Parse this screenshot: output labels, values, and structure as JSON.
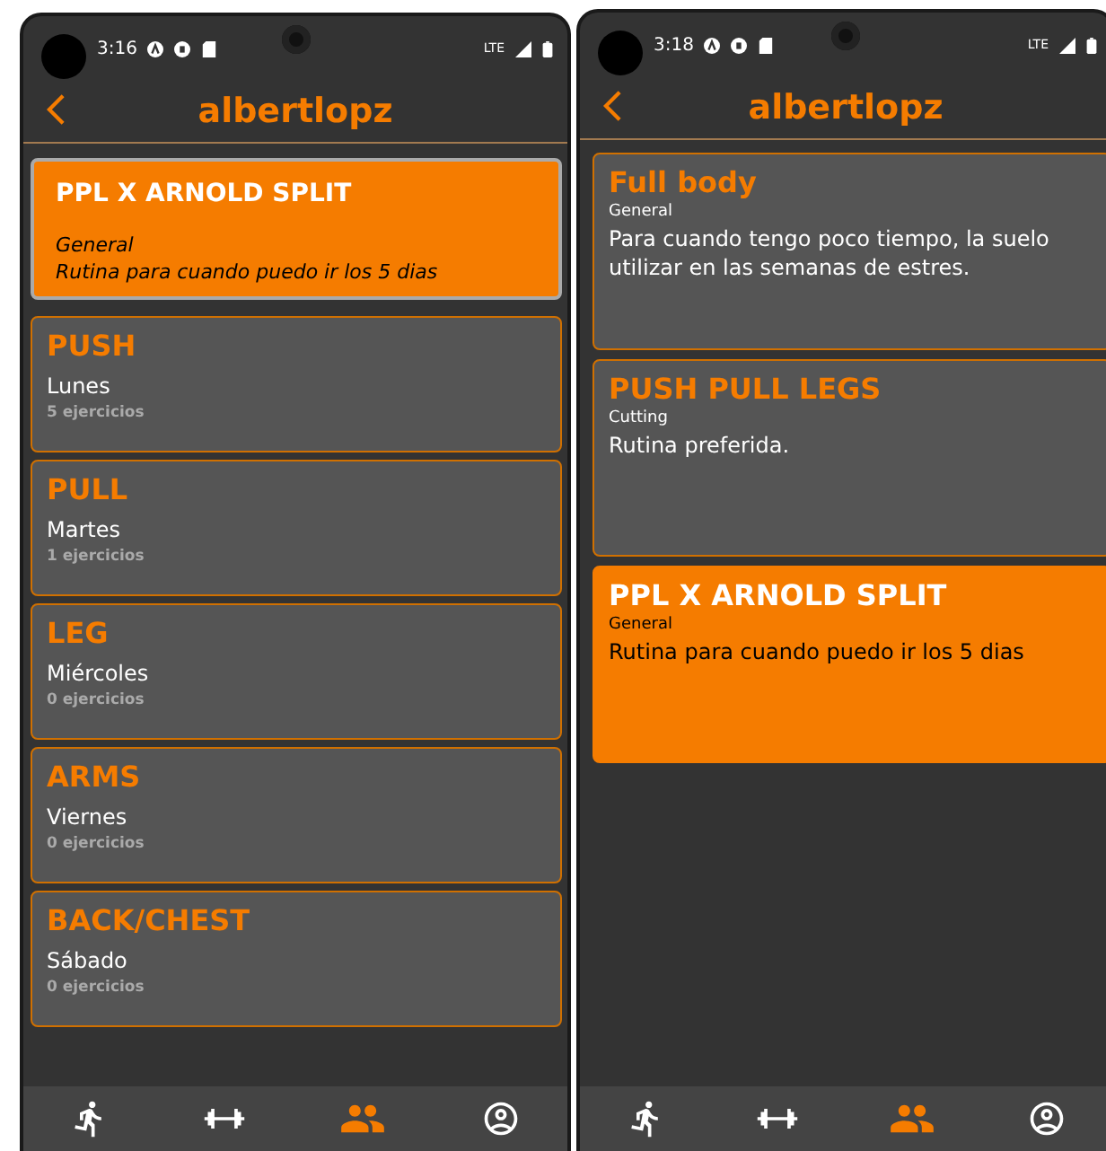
{
  "screens": [
    {
      "time": "3:16",
      "network": "LTE",
      "title": "albertlopz",
      "cards": [
        {
          "kind": "plan",
          "selected": true,
          "title": "PPL X ARNOLD SPLIT",
          "subtitle": "General",
          "description": "Rutina para cuando puedo ir los 5 dias"
        },
        {
          "kind": "day",
          "selected": false,
          "title": "PUSH",
          "subtitle": "Lunes",
          "description": "5 ejercicios"
        },
        {
          "kind": "day",
          "selected": false,
          "title": "PULL",
          "subtitle": "Martes",
          "description": "1 ejercicios"
        },
        {
          "kind": "day",
          "selected": false,
          "title": "LEG",
          "subtitle": "Miércoles",
          "description": "0 ejercicios"
        },
        {
          "kind": "day",
          "selected": false,
          "title": "ARMS",
          "subtitle": "Viernes",
          "description": "0 ejercicios"
        },
        {
          "kind": "day",
          "selected": false,
          "title": "BACK/CHEST",
          "subtitle": "Sábado",
          "description": "0 ejercicios"
        }
      ],
      "nav": [
        {
          "kind": "run",
          "selected": false
        },
        {
          "kind": "gym",
          "selected": false
        },
        {
          "kind": "people",
          "selected": true
        },
        {
          "kind": "profile",
          "selected": false
        }
      ]
    },
    {
      "time": "3:18",
      "network": "LTE",
      "title": "albertlopz",
      "cards": [
        {
          "kind": "routine",
          "selected": false,
          "title": "Full body",
          "subtitle": "General",
          "description": "Para cuando tengo poco tiempo, la suelo utilizar en las semanas de estres."
        },
        {
          "kind": "routine",
          "selected": false,
          "title": "PUSH PULL LEGS",
          "subtitle": "Cutting",
          "description": "Rutina preferida."
        },
        {
          "kind": "routine",
          "selected": true,
          "title": "PPL X ARNOLD SPLIT",
          "subtitle": "General",
          "description": "Rutina para cuando puedo ir los 5 dias"
        }
      ],
      "nav": [
        {
          "kind": "run",
          "selected": false
        },
        {
          "kind": "gym",
          "selected": false
        },
        {
          "kind": "people",
          "selected": true
        },
        {
          "kind": "profile",
          "selected": false
        }
      ]
    }
  ]
}
